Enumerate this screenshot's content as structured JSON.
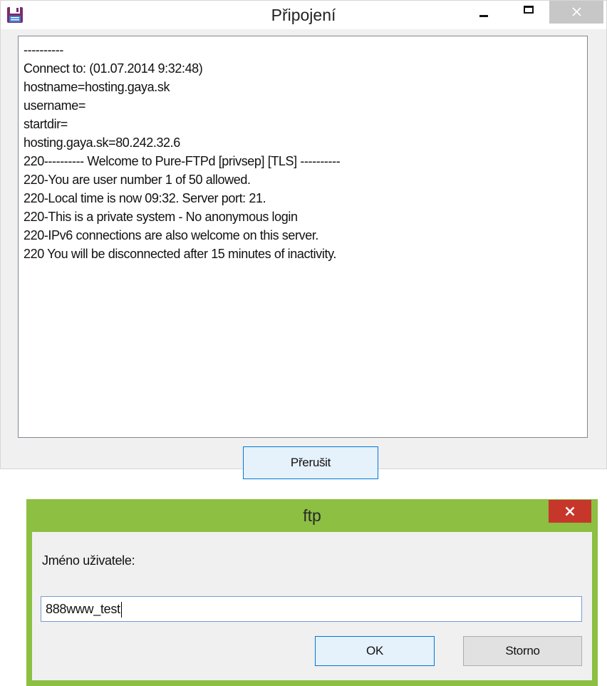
{
  "connection_window": {
    "title": "Připojení",
    "log_lines": [
      "----------",
      "Connect to: (01.07.2014 9:32:48)",
      "hostname=hosting.gaya.sk",
      "username=",
      "startdir=",
      "hosting.gaya.sk=80.242.32.6",
      "220---------- Welcome to Pure-FTPd [privsep] [TLS] ----------",
      "220-You are user number 1 of 50 allowed.",
      "220-Local time is now 09:32. Server port: 21.",
      "220-This is a private system - No anonymous login",
      "220-IPv6 connections are also welcome on this server.",
      "220 You will be disconnected after 15 minutes of inactivity."
    ],
    "interrupt_button": "Přerušit",
    "icons": {
      "app": "floppy-disk-icon",
      "minimize": "minimize-icon",
      "maximize": "maximize-icon",
      "close": "close-icon"
    }
  },
  "ftp_dialog": {
    "title": "ftp",
    "prompt_label": "Jméno uživatele:",
    "username_value": "888www_test",
    "ok_button": "OK",
    "cancel_button": "Storno",
    "accent_color": "#8cbf42",
    "close_color": "#c7362b"
  }
}
